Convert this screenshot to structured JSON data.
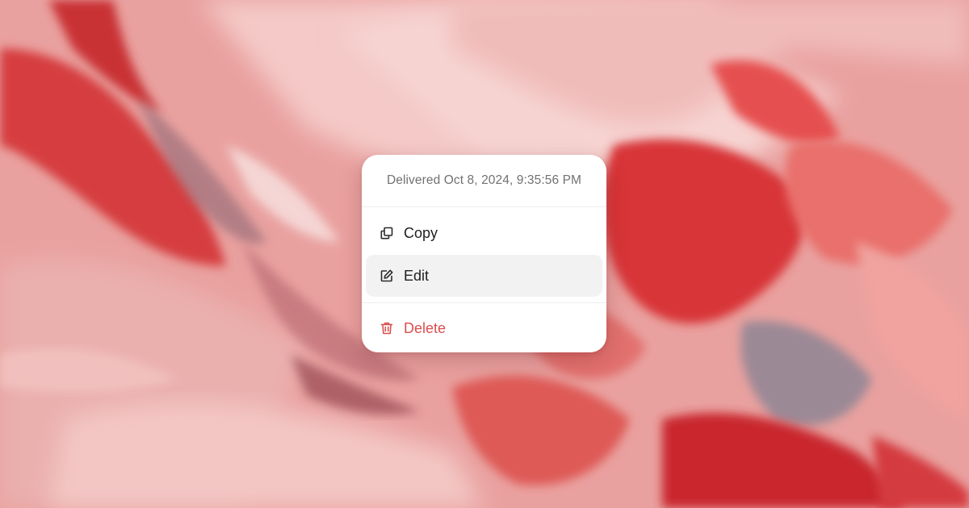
{
  "background": {
    "description_colors": [
      "#e89a98",
      "#f3c4c2",
      "#d63a3a",
      "#b9202a",
      "#8a7a86",
      "#fbe1e0"
    ]
  },
  "menu": {
    "header": "Delivered Oct 8, 2024, 9:35:56 PM",
    "items": [
      {
        "label": "Copy",
        "icon": "copy-icon",
        "state": "normal"
      },
      {
        "label": "Edit",
        "icon": "edit-icon",
        "state": "hover"
      },
      {
        "label": "Delete",
        "icon": "trash-icon",
        "state": "danger"
      }
    ],
    "colors": {
      "danger": "#d94f4f",
      "hover_bg": "#f2f2f2",
      "text": "#1f1f1f",
      "muted": "#717171"
    }
  }
}
